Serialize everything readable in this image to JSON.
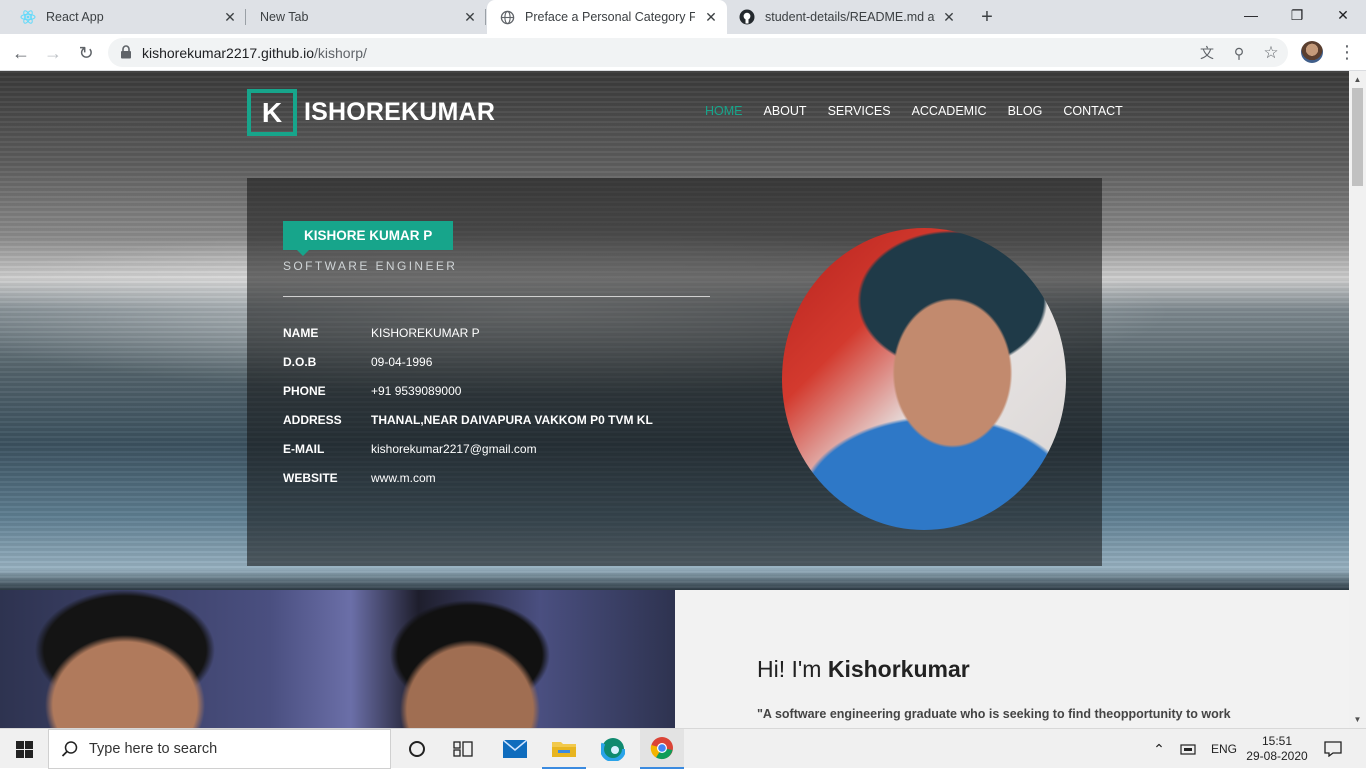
{
  "browser": {
    "tabs": [
      {
        "title": "React App",
        "icon": "react-icon",
        "active": false
      },
      {
        "title": "New Tab",
        "icon": "",
        "active": false
      },
      {
        "title": "Preface a Personal Category Flat",
        "icon": "globe-icon",
        "active": true
      },
      {
        "title": "student-details/README.md at m",
        "icon": "github-icon",
        "active": false
      }
    ],
    "url_host": "kishorekumar2217.github.io",
    "url_path": "/kishorp/"
  },
  "site": {
    "logo_letter": "K",
    "logo_text": "ISHOREKUMAR",
    "nav": [
      "HOME",
      "ABOUT",
      "SERVICES",
      "ACCADEMIC",
      "BLOG",
      "CONTACT"
    ],
    "active_nav": "HOME",
    "accent_color": "#17a58b"
  },
  "profile": {
    "name_badge": "KISHORE KUMAR P",
    "role": "SOFTWARE ENGINEER",
    "fields": [
      {
        "label": "NAME",
        "value": "KISHOREKUMAR P"
      },
      {
        "label": "D.O.B",
        "value": "09-04-1996"
      },
      {
        "label": "PHONE",
        "value": "+91 9539089000"
      },
      {
        "label": "ADDRESS",
        "value": "THANAL,NEAR DAIVAPURA VAKKOM P0 TVM KL"
      },
      {
        "label": "E-MAIL",
        "value": "kishorekumar2217@gmail.com"
      },
      {
        "label": "WEBSITE",
        "value": "www.m.com"
      }
    ]
  },
  "about": {
    "greeting": "Hi! I'm",
    "name": "Kishorkumar",
    "quote": "\"A software engineering graduate who is seeking to find theopportunity to work"
  },
  "taskbar": {
    "search_placeholder": "Type here to search",
    "language": "ENG",
    "time": "15:51",
    "date": "29-08-2020"
  }
}
